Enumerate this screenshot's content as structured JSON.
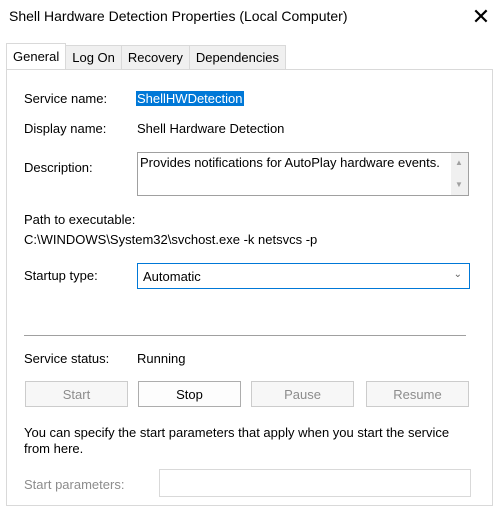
{
  "window": {
    "title": "Shell Hardware Detection Properties (Local Computer)",
    "close_glyph": "✕"
  },
  "tabs": [
    {
      "label": "General",
      "active": true
    },
    {
      "label": "Log On"
    },
    {
      "label": "Recovery"
    },
    {
      "label": "Dependencies"
    }
  ],
  "general": {
    "service_name_label": "Service name:",
    "service_name_value": "ShellHWDetection",
    "display_name_label": "Display name:",
    "display_name_value": "Shell Hardware Detection",
    "description_label": "Description:",
    "description_value": "Provides notifications for AutoPlay hardware events.",
    "path_label": "Path to executable:",
    "path_value": "C:\\WINDOWS\\System32\\svchost.exe -k netsvcs -p",
    "startup_type_label": "Startup type:",
    "startup_type_value": "Automatic",
    "status_label": "Service status:",
    "status_value": "Running",
    "buttons": {
      "start": "Start",
      "stop": "Stop",
      "pause": "Pause",
      "resume": "Resume"
    },
    "hint": "You can specify the start parameters that apply when you start the service from here.",
    "start_params_label": "Start parameters:",
    "start_params_value": ""
  },
  "colors": {
    "accent": "#0078d7",
    "disabled_text": "#8c8c8c"
  },
  "icons": {
    "close": "close-icon",
    "scroll_up": "scroll-up-icon",
    "scroll_down": "scroll-down-icon",
    "dropdown": "chevron-down-icon"
  }
}
